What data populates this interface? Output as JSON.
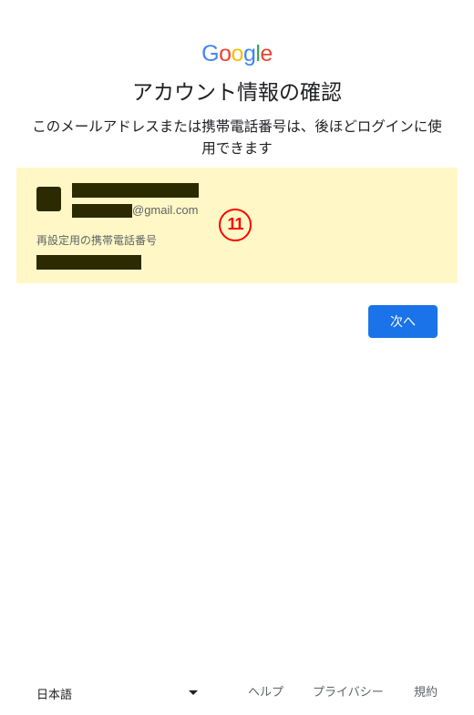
{
  "logo": {
    "letters": [
      {
        "char": "G",
        "color": "#4285F4"
      },
      {
        "char": "o",
        "color": "#EA4335"
      },
      {
        "char": "o",
        "color": "#FBBC05"
      },
      {
        "char": "g",
        "color": "#4285F4"
      },
      {
        "char": "l",
        "color": "#34A853"
      },
      {
        "char": "e",
        "color": "#EA4335"
      }
    ]
  },
  "title": "アカウント情報の確認",
  "subtitle": "このメールアドレスまたは携帯電話番号は、後ほどログインに使用できます",
  "account_panel": {
    "background": "#fff8c6",
    "email_domain": "@gmail.com",
    "annotation_marker": "11",
    "annotation_color": "#ff0000",
    "phone_label": "再設定用の携帯電話番号"
  },
  "actions": {
    "next_label": "次へ",
    "next_color": "#1a73e8"
  },
  "footer": {
    "language": "日本語",
    "help": "ヘルプ",
    "privacy": "プライバシー",
    "terms": "規約"
  }
}
